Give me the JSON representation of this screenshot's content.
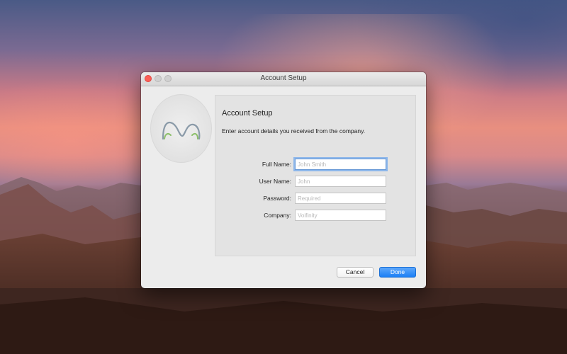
{
  "window": {
    "title": "Account Setup"
  },
  "panel": {
    "heading": "Account Setup",
    "description": "Enter account details you received from the company."
  },
  "form": {
    "full_name": {
      "label": "Full Name:",
      "value": "",
      "placeholder": "John Smith"
    },
    "user_name": {
      "label": "User Name:",
      "value": "",
      "placeholder": "John"
    },
    "password": {
      "label": "Password:",
      "value": "",
      "placeholder": "Required"
    },
    "company": {
      "label": "Company:",
      "value": "",
      "placeholder": "Voifinity"
    }
  },
  "buttons": {
    "cancel": "Cancel",
    "done": "Done"
  },
  "icons": {
    "close": "close-icon",
    "minimize": "minimize-icon",
    "zoom": "zoom-icon",
    "logo": "app-logo-icon"
  },
  "colors": {
    "accent": "#1c7ff5",
    "close": "#fc5f57",
    "logo_green": "#8cbf6a",
    "logo_gray": "#8a9aa8"
  }
}
